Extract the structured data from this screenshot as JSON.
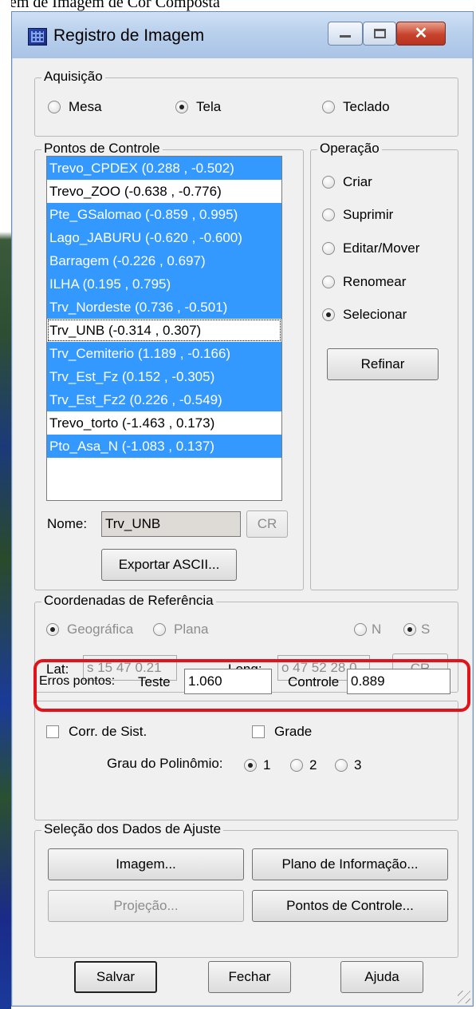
{
  "caption": "gem de Imagem de Cor Composta",
  "window": {
    "title": "Registro de Imagem"
  },
  "aquisicao": {
    "legend": "Aquisição",
    "options": [
      {
        "label": "Mesa",
        "selected": false
      },
      {
        "label": "Tela",
        "selected": true
      },
      {
        "label": "Teclado",
        "selected": false
      }
    ]
  },
  "pontos": {
    "legend": "Pontos de Controle",
    "items": [
      {
        "label": "Trevo_CPDEX (0.288 , -0.502)",
        "selected": true
      },
      {
        "label": "Trevo_ZOO (-0.638 , -0.776)",
        "selected": false
      },
      {
        "label": "Pte_GSalomao (-0.859 , 0.995)",
        "selected": true
      },
      {
        "label": "Lago_JABURU (-0.620 , -0.600)",
        "selected": true
      },
      {
        "label": "Barragem (-0.226 , 0.697)",
        "selected": true
      },
      {
        "label": "ILHA (0.195 , 0.795)",
        "selected": true
      },
      {
        "label": "Trv_Nordeste (0.736 , -0.501)",
        "selected": true
      },
      {
        "label": "Trv_UNB (-0.314 , 0.307)",
        "selected": false
      },
      {
        "label": "Trv_Cemiterio (1.189 , -0.166)",
        "selected": true
      },
      {
        "label": "Trv_Est_Fz (0.152 , -0.305)",
        "selected": true
      },
      {
        "label": "Trv_Est_Fz2 (0.226 , -0.549)",
        "selected": true
      },
      {
        "label": "Trevo_torto (-1.463 , 0.173)",
        "selected": false
      },
      {
        "label": "Pto_Asa_N (-1.083 , 0.137)",
        "selected": true
      }
    ],
    "nome_label": "Nome:",
    "nome_value": "Trv_UNB",
    "cr_label": "CR",
    "exportar_label": "Exportar ASCII..."
  },
  "operacao": {
    "legend": "Operação",
    "options": [
      {
        "label": "Criar",
        "selected": false
      },
      {
        "label": "Suprimir",
        "selected": false
      },
      {
        "label": "Editar/Mover",
        "selected": false
      },
      {
        "label": "Renomear",
        "selected": false
      },
      {
        "label": "Selecionar",
        "selected": true
      }
    ],
    "refinar_label": "Refinar"
  },
  "coordenadas": {
    "legend": "Coordenadas de Referência",
    "geografica": "Geográfica",
    "plana": "Plana",
    "n": "N",
    "s": "S",
    "lat_label": "Lat:",
    "lat_value": "s 15 47 0.21",
    "long_label": "Long:",
    "long_value": "o 47 52 28.0",
    "cr_label": "CR"
  },
  "ajuste": {
    "corr_sist": "Corr. de Sist.",
    "grade": "Grade",
    "grau_label": "Grau do Polinômio:",
    "grau_options": [
      "1",
      "2",
      "3"
    ],
    "grau_selected": "1",
    "erros_label": "Erros pontos:",
    "teste_label": "Teste",
    "teste_value": "1.060",
    "controle_label": "Controle",
    "controle_value": "0.889",
    "highlight_color": "#e0141b"
  },
  "selecao": {
    "legend": "Seleção dos Dados de Ajuste",
    "imagem": "Imagem...",
    "plano": "Plano de Informação...",
    "projecao": "Projeção...",
    "pontos": "Pontos de Controle..."
  },
  "footer": {
    "salvar": "Salvar",
    "fechar": "Fechar",
    "ajuda": "Ajuda"
  }
}
